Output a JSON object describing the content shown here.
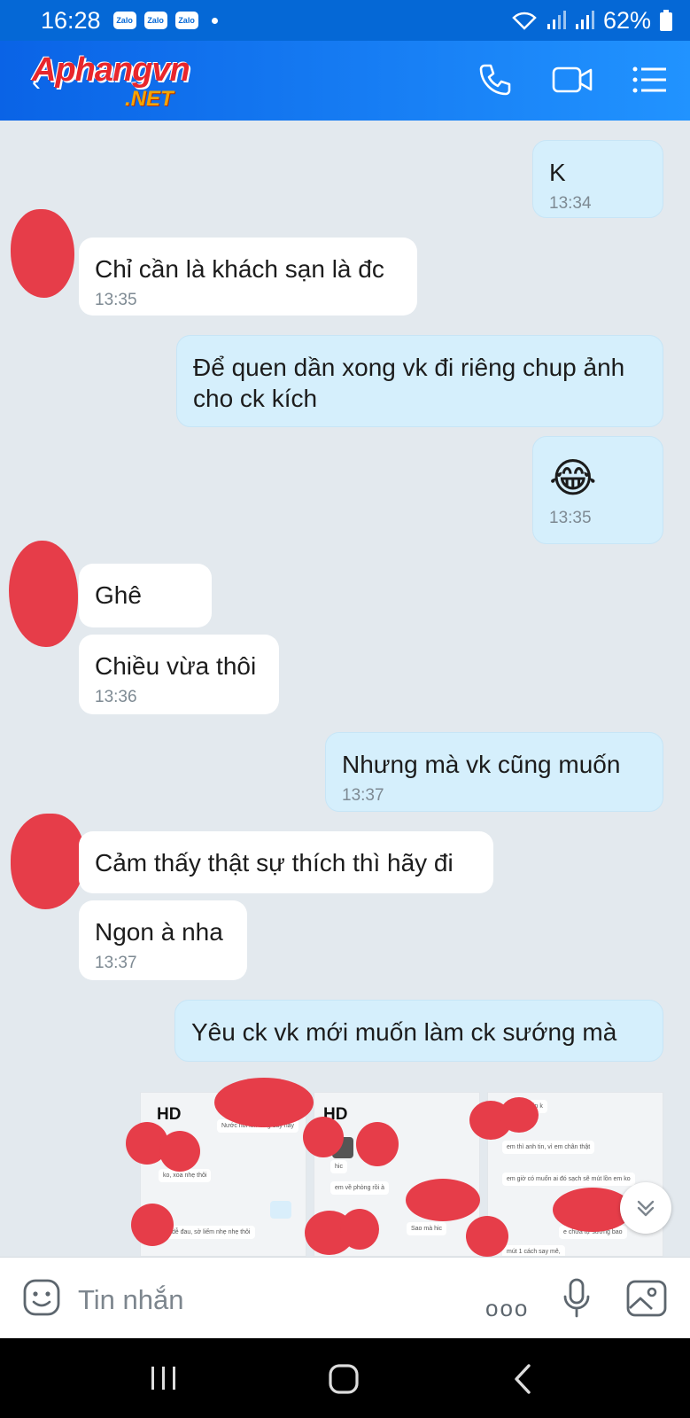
{
  "status_bar": {
    "time": "16:28",
    "notifications": [
      "Zalo",
      "Zalo",
      "Zalo"
    ],
    "battery": "62%"
  },
  "header": {
    "logo_main": "Aphangvn",
    "logo_sub": ".NET",
    "icons": [
      "back-arrow-icon",
      "phone-icon",
      "video-call-icon",
      "menu-list-icon"
    ]
  },
  "messages": [
    {
      "dir": "out",
      "text": "K",
      "time": "13:34"
    },
    {
      "dir": "in",
      "text": "Chỉ cần là khách sạn là đc",
      "time": "13:35"
    },
    {
      "dir": "out",
      "text": "Để quen dần xong vk đi riêng chup ảnh cho ck kích",
      "time": ""
    },
    {
      "dir": "out",
      "text": "😂",
      "time": "13:35"
    },
    {
      "dir": "in",
      "text": "Ghê",
      "time": ""
    },
    {
      "dir": "in",
      "text": "Chiều vừa thôi",
      "time": "13:36"
    },
    {
      "dir": "out",
      "text": "Nhưng mà vk cũng muốn",
      "time": "13:37"
    },
    {
      "dir": "in",
      "text": "Cảm thấy thật sự thích thì hãy đi",
      "time": ""
    },
    {
      "dir": "in",
      "text": "Ngon à nha",
      "time": "13:37"
    },
    {
      "dir": "out",
      "text": "Yêu ck vk mới muốn làm ck sướng mà",
      "time": ""
    }
  ],
  "image_strip": {
    "badges": [
      "HD",
      "HD"
    ],
    "thumb1_snippets": [
      "Nước nói lên láng đây này",
      "ko, xoa nhẹ thôi",
      "n dễ đau, sờ liếm nhẹ nhẹ thôi"
    ],
    "thumb2_snippets": [
      "hic",
      "em về phòng rồi à",
      "Sao mà hic"
    ],
    "thumb3_snippets": [
      "tin k",
      "em thì anh tin, vì em chân thật",
      "em giờ có muốn ai đó sạch sẽ mút lồn em ko",
      "e chưa tự sướng bao",
      "mút 1 cách say mê,"
    ]
  },
  "input_bar": {
    "placeholder": "Tin nhắn",
    "more_label": "ooo"
  },
  "colors": {
    "header": "#0a63e6",
    "incoming_bubble": "#ffffff",
    "outgoing_bubble": "#d5effc",
    "chat_background": "#e3e9ee",
    "redaction": "#e63d49"
  }
}
